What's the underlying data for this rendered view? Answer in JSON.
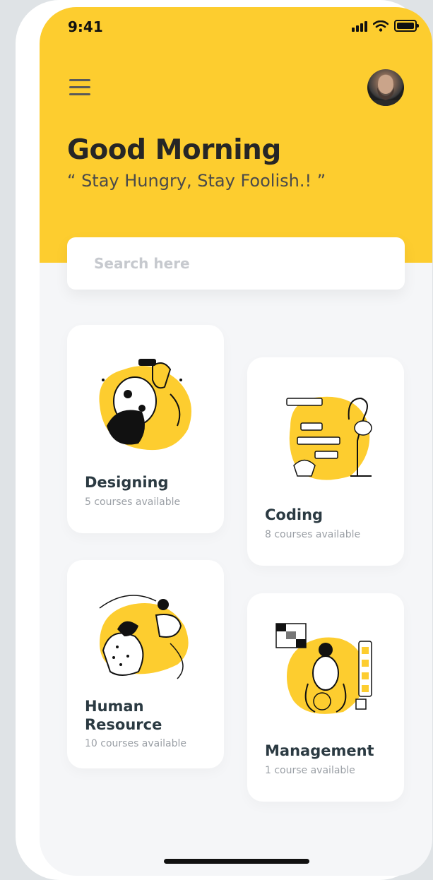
{
  "status": {
    "time": "9:41"
  },
  "header": {
    "greeting": "Good Morning",
    "quote": "“ Stay Hungry, Stay Foolish.! ”"
  },
  "search": {
    "placeholder": "Search here",
    "value": ""
  },
  "courses": [
    {
      "title": "Designing",
      "subtitle": "5 courses available"
    },
    {
      "title": "Coding",
      "subtitle": "8 courses available"
    },
    {
      "title": "Human\nResource",
      "subtitle": "10 courses available"
    },
    {
      "title": "Management",
      "subtitle": "1 course available"
    }
  ],
  "colors": {
    "accent": "#fdcd2f",
    "background": "#f5f6f8",
    "card": "#ffffff",
    "title": "#2b3a42"
  }
}
